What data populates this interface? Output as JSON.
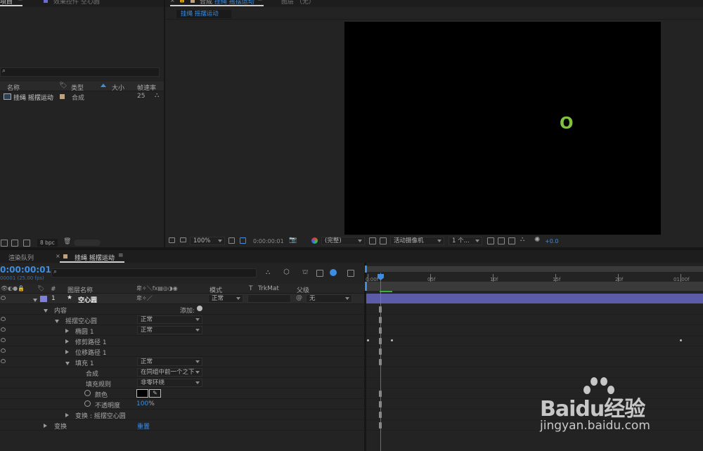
{
  "project_panel": {
    "tab_label": "项目",
    "effects_tab_label": "效果控件 空心圆",
    "search_placeholder": "",
    "columns": [
      "名称",
      "类型",
      "大小",
      "帧速率"
    ],
    "items": [
      {
        "name": "挂绳 摇摆运动",
        "type": "合成",
        "size": "",
        "fps": "25"
      }
    ],
    "bpc": "8 bpc"
  },
  "composition_panel": {
    "tab_label": "合成",
    "comp_name": "挂绳 摇摆运动",
    "layer_tab_label": "图层 （无）",
    "flow_tab": "挂绳 摇摆运动",
    "zoom": "100%",
    "timecode": "0:00:00:01",
    "quality": "(完整)",
    "camera": "活动摄像机",
    "views": "1 个...",
    "exposure": "+0.0",
    "canvas_glyph": "O",
    "canvas_glyph_color": "#7fc241"
  },
  "timeline_panel": {
    "tab_render_queue": "渲染队列",
    "tab_comp": "挂绳 摇摆运动",
    "current_time": "0:00:00:01",
    "frame_info": "00001 (25.00 fps)",
    "search_placeholder": "",
    "columns": {
      "num": "#",
      "layer_name": "图层名称",
      "mode": "模式",
      "t": "T",
      "trkmat": "TrkMat",
      "parent": "父级"
    },
    "layer": {
      "index": "1",
      "name": "空心圆",
      "mode": "正常",
      "parent": "无",
      "color": "#7f7fe0"
    },
    "rows": [
      {
        "label": "内容",
        "indent": 1,
        "expanded": true,
        "add_label": "添加:"
      },
      {
        "label": "摇摆空心圆",
        "indent": 2,
        "expanded": true,
        "value": "正常"
      },
      {
        "label": "椭圆 1",
        "indent": 3,
        "expanded": false,
        "value": "正常"
      },
      {
        "label": "修剪路径 1",
        "indent": 3,
        "expanded": false
      },
      {
        "label": "位移路径 1",
        "indent": 3,
        "expanded": false
      },
      {
        "label": "填充 1",
        "indent": 3,
        "expanded": true,
        "value": "正常"
      },
      {
        "label": "合成",
        "indent": 4,
        "value": "在同组中前一个之下"
      },
      {
        "label": "填充规则",
        "indent": 4,
        "value": "非零环绕"
      },
      {
        "label": "颜色",
        "indent": 4,
        "stopwatch": true
      },
      {
        "label": "不透明度",
        "indent": 4,
        "stopwatch": true,
        "value_num": "100",
        "unit": "%"
      },
      {
        "label": "变换 : 摇摆空心圆",
        "indent": 3,
        "expanded": false
      },
      {
        "label": "变换",
        "indent": 1,
        "expanded": false,
        "reset": "重置"
      }
    ],
    "ruler_ticks": [
      "0:00f",
      "05f",
      "10f",
      "15f",
      "20f",
      "01:00f"
    ]
  },
  "watermark": {
    "brand": "Baidu经验",
    "url": "jingyan.baidu.com"
  }
}
